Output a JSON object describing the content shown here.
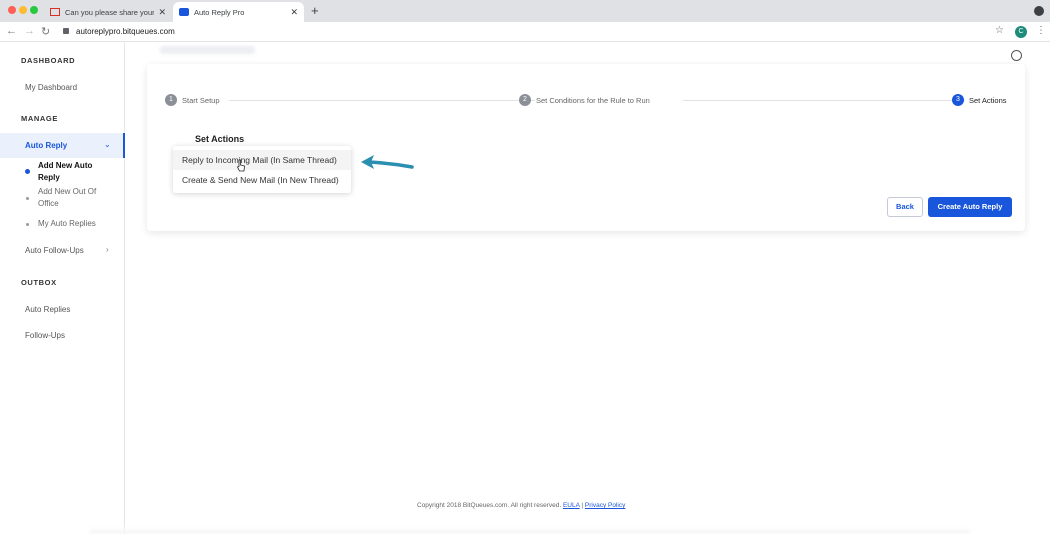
{
  "browser": {
    "tabs": [
      {
        "title": "Can you please share your me",
        "icon": "gmail-icon"
      },
      {
        "title": "Auto Reply Pro",
        "icon": "auto-reply-pro-icon"
      }
    ],
    "url": "autoreplypro.bitqueues.com",
    "avatar_letter": "C"
  },
  "sidebar": {
    "dashboard_head": "DASHBOARD",
    "my_dashboard": "My Dashboard",
    "manage_head": "MANAGE",
    "auto_reply": "Auto Reply",
    "sub_items": [
      "Add New Auto Reply",
      "Add New Out Of Office",
      "My Auto Replies"
    ],
    "auto_followups": "Auto Follow-Ups",
    "outbox_head": "OUTBOX",
    "auto_replies": "Auto Replies",
    "followups": "Follow-Ups"
  },
  "stepper": {
    "steps": [
      {
        "number": "1",
        "label": "Start Setup"
      },
      {
        "number": "2",
        "label": "Set Conditions for the Rule to Run"
      },
      {
        "number": "3",
        "label": "Set Actions"
      }
    ],
    "current_step": 3
  },
  "card": {
    "title": "Set Actions",
    "options": [
      "Reply to Incoming Mail (In Same Thread)",
      "Create & Send New Mail (In New Thread)"
    ],
    "back_label": "Back",
    "create_label": "Create Auto Reply"
  },
  "footer": {
    "copyright": "Copyright 2018 BitQueues.com. All right reserved.",
    "eula": "EULA",
    "separator": "|",
    "privacy": "Privacy Policy"
  },
  "colors": {
    "accent": "#1a56db",
    "annotation_arrow": "#2a8fb0"
  }
}
